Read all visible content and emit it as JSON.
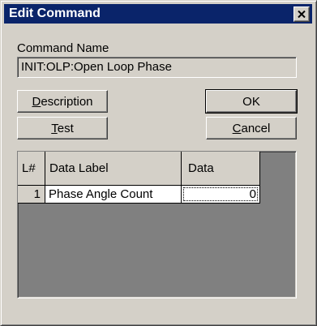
{
  "window": {
    "title": "Edit Command"
  },
  "command": {
    "label": "Command Name",
    "value": "INIT:OLP:Open Loop Phase"
  },
  "buttons": {
    "description": {
      "first": "D",
      "rest": "escription"
    },
    "test": {
      "first": "T",
      "rest": "est"
    },
    "ok": "OK",
    "cancel": {
      "first": "C",
      "rest": "ancel"
    }
  },
  "table": {
    "headers": [
      "L#",
      "Data Label",
      "Data"
    ],
    "rows": [
      {
        "num": "1",
        "label": "Phase Angle Count",
        "data": "0"
      }
    ]
  },
  "colors": {
    "titlebar": "#0a246a",
    "face": "#d4d0c8",
    "grid_bg": "#808080"
  },
  "icons": {
    "close": "close-icon"
  }
}
